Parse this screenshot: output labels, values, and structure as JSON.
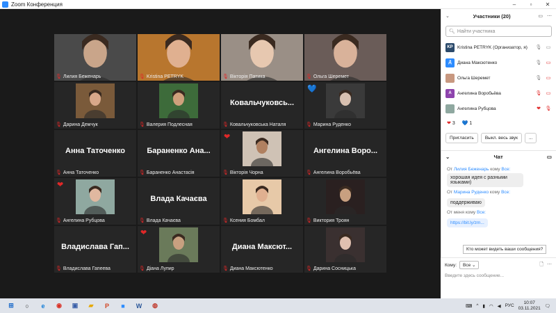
{
  "window": {
    "title": "Zoom Конференция",
    "minimize": "–",
    "maximize": "▫",
    "close": "✕"
  },
  "tiles": [
    {
      "name": "Лилия Беженарь",
      "photo": true,
      "bg": "#4a4a4a",
      "skin": "#c9a58a"
    },
    {
      "name": "Kristina PETRYK",
      "photo": true,
      "bg": "#b8762e",
      "skin": "#e0b090",
      "active": true
    },
    {
      "name": "Вікторія Патика",
      "photo": true,
      "bg": "#9a8f86",
      "skin": "#e7c8b0"
    },
    {
      "name": "Ольга Шеремет",
      "photo": true,
      "bg": "#6a5c58",
      "skin": "#d9b29a"
    },
    {
      "name": "Дарина Демчук",
      "photo": true,
      "bg": "#7a5a3a",
      "skin": "#d9a88a"
    },
    {
      "name": "Валерия Подлесная",
      "photo": true,
      "bg": "#3d6b3a",
      "skin": "#cfa07c"
    },
    {
      "name": "Ковальчуковська Наталя",
      "bigname": "Ковальчуковсь..."
    },
    {
      "name": "Марина Руденко",
      "photo": true,
      "bg": "#3a3a3a",
      "skin": "#d8c0b0",
      "reaction": "💙"
    },
    {
      "name": "Анна Таточенко",
      "bigname": "Анна Таточенко"
    },
    {
      "name": "Бараненко Анастасія",
      "bigname": "Бараненко Ана..."
    },
    {
      "name": "Вікторія Чорна",
      "photo": true,
      "bg": "#cfc2b5",
      "skin": "#b08060",
      "reaction": "❤"
    },
    {
      "name": "Ангелина Воробьёва",
      "bigname": "Ангелина Воро..."
    },
    {
      "name": "Ангелина Рубцова",
      "photo": true,
      "bg": "#8fa8a0",
      "skin": "#e0b8a0",
      "reaction": "❤"
    },
    {
      "name": "Влада Качаєва",
      "bigname": "Влада Качаєва"
    },
    {
      "name": "Ксения Бомбал",
      "photo": true,
      "bg": "#e7c9a8",
      "skin": "#e0b090"
    },
    {
      "name": "Виктория Троян",
      "photo": true,
      "bg": "#2a2020",
      "skin": "#c8a080"
    },
    {
      "name": "Владислава Гапеева",
      "bigname": "Владислава Гап..."
    },
    {
      "name": "Діана Лупир",
      "photo": true,
      "bg": "#6a7a5a",
      "skin": "#c8a080",
      "reaction": "❤"
    },
    {
      "name": "Диана Максютенко",
      "bigname": "Диана Максют..."
    },
    {
      "name": "Дарина Сосницька",
      "photo": true,
      "bg": "#3a3030",
      "skin": "#e0c0b0"
    }
  ],
  "participants": {
    "title": "Участники (20)",
    "search_placeholder": "Найти участника",
    "rows": [
      {
        "initials": "KP",
        "color": "#2b4a6b",
        "name": "Kristina PETRYK (Организатор, я)",
        "mic": "🎙",
        "mic_color": "#888",
        "cam": "▭",
        "cam_color": "#888"
      },
      {
        "initials": "Д",
        "color": "#2d8cff",
        "name": "Диана Максютенко",
        "mic": "🎙",
        "mic_color": "#888",
        "cam": "▭",
        "cam_color": "#e02828"
      },
      {
        "initials": "",
        "color": "#c89880",
        "name": "Ольга Шеремет",
        "mic": "🎙",
        "mic_color": "#888",
        "cam": "▭",
        "cam_color": "#e02828"
      },
      {
        "initials": "А",
        "color": "#8e44ad",
        "name": "Ангелина Воробьёва",
        "mic": "🎙",
        "mic_color": "#e02828",
        "cam": "▭",
        "cam_color": "#e02828"
      },
      {
        "initials": "",
        "color": "#8fa8a0",
        "name": "Ангелина Рубцова",
        "mic": "❤",
        "mic_color": "#e02828",
        "cam": "🎙",
        "cam_color": "#e02828"
      }
    ],
    "reactions": [
      {
        "icon": "❤",
        "color": "#e02828",
        "count": "3"
      },
      {
        "icon": "💙",
        "color": "#2dbfff",
        "count": "1"
      }
    ],
    "invite_label": "Пригласить",
    "mute_all_label": "Выкл. весь звук",
    "more_label": "..."
  },
  "chat": {
    "title": "Чат",
    "messages": [
      {
        "from_prefix": "От",
        "from": "Лилия Беженарь",
        "to_prefix": "кому",
        "to": "Все:",
        "text": "хорошая идея с разными языками)"
      },
      {
        "from_prefix": "От",
        "from": "Марина Руденко",
        "to_prefix": "кому",
        "to": "Все:",
        "text": "поддерживаю"
      },
      {
        "from_prefix": "От меня",
        "from": "",
        "to_prefix": "кому",
        "to": "Все:",
        "link": "https://bit.ly/zm..."
      }
    ],
    "tooltip": "Кто может видеть ваши сообщения?",
    "to_label": "Кому:",
    "to_value": "Все",
    "input_placeholder": "Введите здесь сообщение..."
  },
  "taskbar": {
    "apps": [
      {
        "name": "windows-start",
        "glyph": "⊞",
        "color": "#1b6ac9"
      },
      {
        "name": "search",
        "glyph": "○",
        "color": "#222"
      },
      {
        "name": "edge",
        "glyph": "e",
        "color": "#0f7bd7"
      },
      {
        "name": "chrome",
        "glyph": "◉",
        "color": "#d93025"
      },
      {
        "name": "save",
        "glyph": "▣",
        "color": "#3a5fa8"
      },
      {
        "name": "explorer",
        "glyph": "▰",
        "color": "#e6a800"
      },
      {
        "name": "powerpoint",
        "glyph": "P",
        "color": "#d24726"
      },
      {
        "name": "zoom",
        "glyph": "■",
        "color": "#2d8cff"
      },
      {
        "name": "word",
        "glyph": "W",
        "color": "#2b579a"
      },
      {
        "name": "photos",
        "glyph": "◍",
        "color": "#c0392b"
      }
    ],
    "lang": "РУС",
    "time": "10:07",
    "date": "03.11.2021"
  }
}
